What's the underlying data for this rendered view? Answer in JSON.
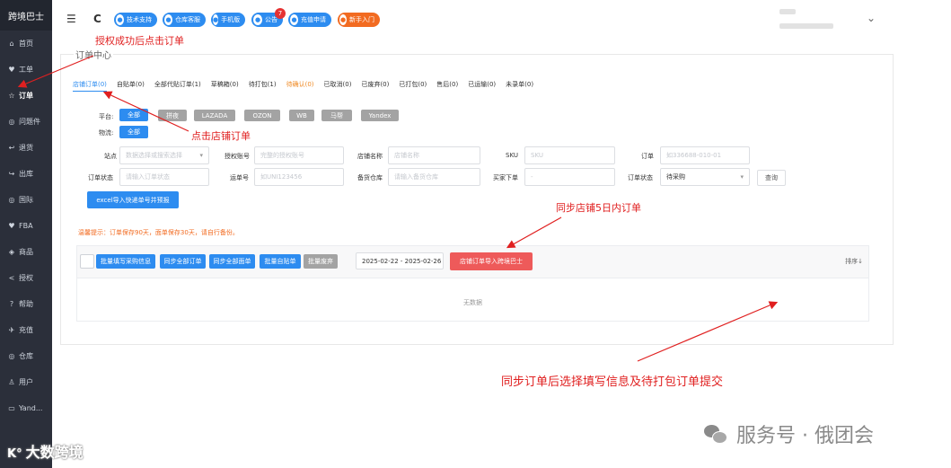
{
  "sidebar": {
    "brand": "跨境巴士",
    "items": [
      {
        "icon": "⌂",
        "label": "首页",
        "active": false
      },
      {
        "icon": "♥",
        "label": "工单",
        "active": false
      },
      {
        "icon": "☆",
        "label": "订单",
        "active": true
      },
      {
        "icon": "◎",
        "label": "问题件",
        "active": false
      },
      {
        "icon": "↩",
        "label": "退货",
        "active": false
      },
      {
        "icon": "↪",
        "label": "出库",
        "active": false
      },
      {
        "icon": "◎",
        "label": "国际",
        "active": false
      },
      {
        "icon": "♥",
        "label": "FBA",
        "active": false
      },
      {
        "icon": "◈",
        "label": "商品",
        "active": false
      },
      {
        "icon": "<",
        "label": "授权",
        "active": false
      },
      {
        "icon": "?",
        "label": "帮助",
        "active": false
      },
      {
        "icon": "✈",
        "label": "充值",
        "active": false
      },
      {
        "icon": "◎",
        "label": "仓库",
        "active": false
      },
      {
        "icon": "♙",
        "label": "用户",
        "active": false
      },
      {
        "icon": "▭",
        "label": "Yand...",
        "active": false
      }
    ]
  },
  "topbar": {
    "menu_icon": "☰",
    "refresh_icon": "C",
    "pills": [
      {
        "label": "技术支持",
        "color": "#2d8cf0"
      },
      {
        "label": "仓库客服",
        "color": "#2d8cf0"
      },
      {
        "label": "手机版",
        "color": "#2d8cf0"
      },
      {
        "label": "公告",
        "color": "#2d8cf0",
        "badge": "7"
      },
      {
        "label": "充值申请",
        "color": "#2d8cf0"
      },
      {
        "label": "新手入门",
        "color": "#f26b21"
      }
    ],
    "dropdown_icon": "⌄"
  },
  "main": {
    "legend": "订单中心",
    "tabs": [
      {
        "label": "店铺订单(0)",
        "state": "active"
      },
      {
        "label": "自贴单(0)",
        "state": ""
      },
      {
        "label": "全部代贴订单(1)",
        "state": ""
      },
      {
        "label": "草稿箱(0)",
        "state": ""
      },
      {
        "label": "待打包(1)",
        "state": ""
      },
      {
        "label": "待确认(0)",
        "state": "pending"
      },
      {
        "label": "已取消(0)",
        "state": ""
      },
      {
        "label": "已废弃(0)",
        "state": ""
      },
      {
        "label": "已打包(0)",
        "state": ""
      },
      {
        "label": "售后(0)",
        "state": ""
      },
      {
        "label": "已运输(0)",
        "state": ""
      },
      {
        "label": "未录单(0)",
        "state": ""
      }
    ],
    "platform_label": "平台:",
    "platforms": [
      "全部",
      "拼夜",
      "LAZADA",
      "OZON",
      "WB",
      "马帮",
      "Yandex"
    ],
    "logistics_label": "物流:",
    "logistics": [
      "全部"
    ],
    "filters_row1": [
      {
        "label": "站点",
        "placeholder": "数据选择或搜索选择"
      },
      {
        "label": "授权账号",
        "placeholder": "完整的授权账号"
      },
      {
        "label": "店铺名称",
        "placeholder": "店铺名称"
      },
      {
        "label": "SKU",
        "placeholder": "SKU"
      },
      {
        "label": "订单",
        "placeholder": "如336688-010-01"
      }
    ],
    "filters_row2": [
      {
        "label": "订单状态",
        "placeholder": "请输入订单状态"
      },
      {
        "label": "运单号",
        "placeholder": "如UNI123456"
      },
      {
        "label": "备货仓库",
        "placeholder": "请输入备货仓库"
      },
      {
        "label": "买家下单",
        "placeholder": "-"
      },
      {
        "label": "订单状态",
        "value": "待采购"
      }
    ],
    "search_button": "查询",
    "import_button": "excel导入快递单号并预报",
    "tip": "温馨提示：订单保存90天，面单保存30天，请自行备份。",
    "toolbar_buttons": [
      "批量填写采购信息",
      "同步全部订单",
      "同步全部面单",
      "批量自贴单",
      "批量废弃"
    ],
    "date_range": "2025-02-22 - 2025-02-26",
    "sync_button": "店铺订单导入跨境巴士",
    "sort_label": "排序↓",
    "empty_text": "无数据"
  },
  "annotations": {
    "a1": "授权成功后点击订单",
    "a2": "点击店铺订单",
    "a3": "同步店铺5日内订单",
    "a4": "同步订单后选择填写信息及待打包订单提交"
  },
  "watermarks": {
    "left": "大数跨境",
    "right": "服务号 · 俄团会"
  }
}
